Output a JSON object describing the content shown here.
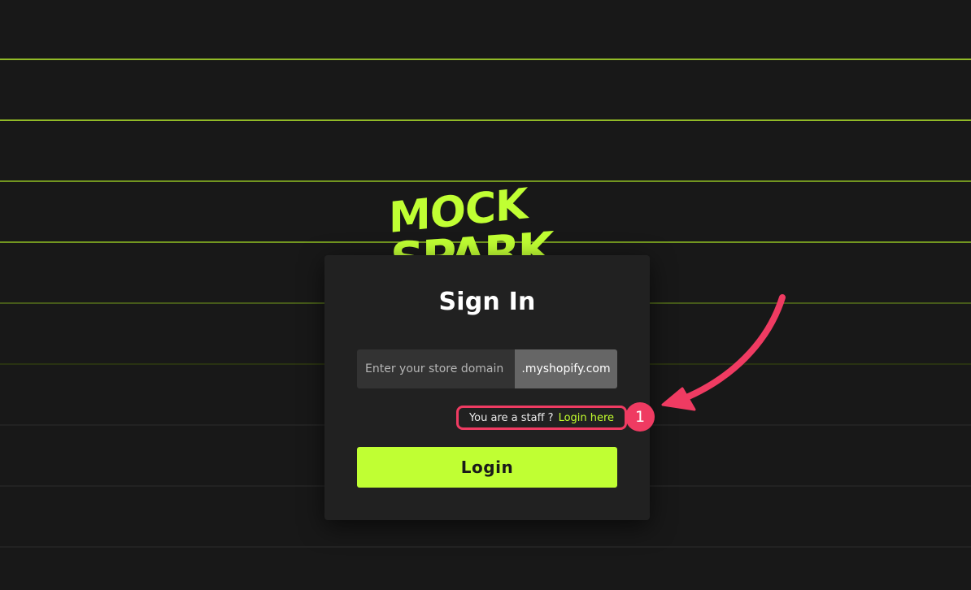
{
  "brand": {
    "logo_line1": "MOCK",
    "logo_line2": "SPARK",
    "accent_color": "#c0ff33"
  },
  "signin": {
    "title": "Sign In",
    "domain_placeholder": "Enter your store domain",
    "domain_value": "",
    "domain_suffix": ".myshopify.com",
    "staff_question": "You are a staff ?",
    "staff_link": "Login here",
    "login_button": "Login"
  },
  "annotation": {
    "step_number": "1",
    "highlight_color": "#ef3b62"
  }
}
